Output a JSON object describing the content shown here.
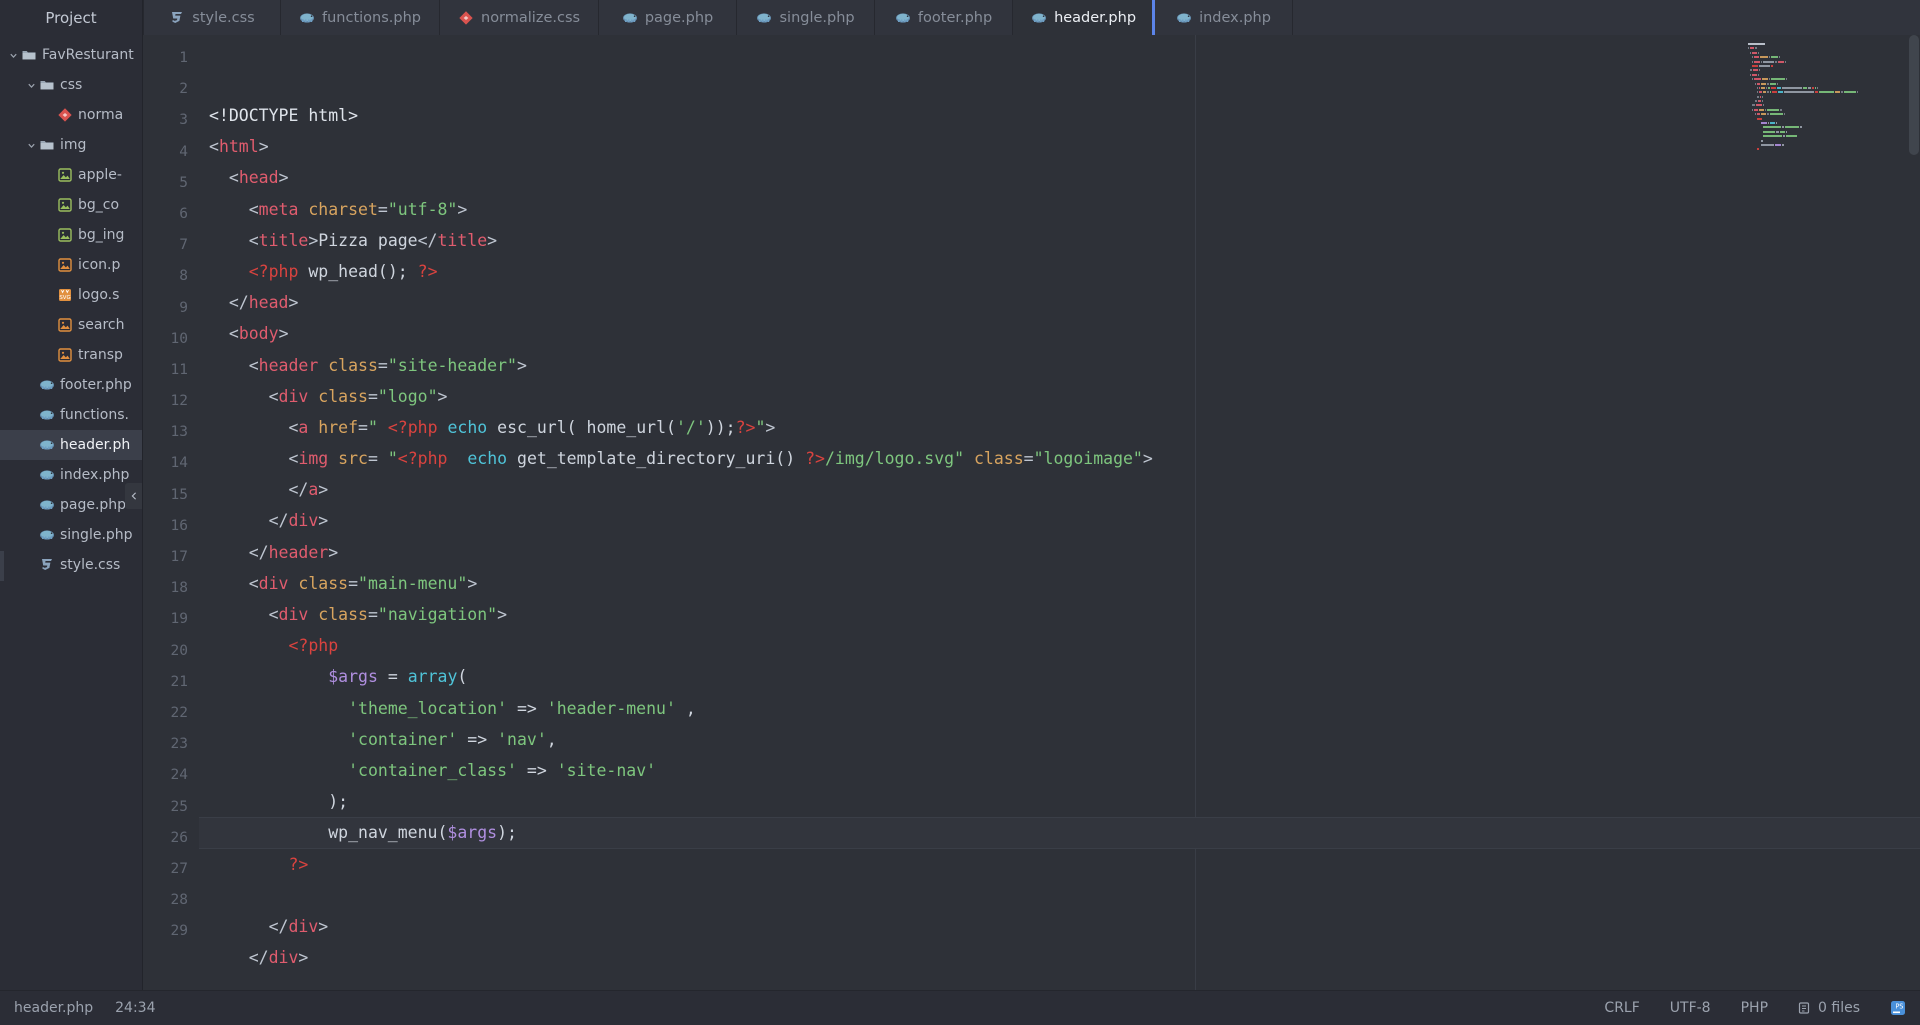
{
  "window": {
    "theme_bg": "#2b2d36",
    "editor_bg": "#2e3138",
    "accent": "#5c84e8"
  },
  "sidebar": {
    "title": "Project",
    "items": [
      {
        "label": "FavResturant",
        "type": "folder",
        "depth": 0,
        "arrow": "chevron-down",
        "selected": false
      },
      {
        "label": "css",
        "type": "folder",
        "depth": 1,
        "arrow": "chevron-down",
        "selected": false
      },
      {
        "label": "norma",
        "type": "css-normalize",
        "depth": 2,
        "arrow": "",
        "selected": false
      },
      {
        "label": "img",
        "type": "folder",
        "depth": 1,
        "arrow": "chevron-down",
        "selected": false
      },
      {
        "label": "apple-",
        "type": "image-green",
        "depth": 2,
        "arrow": "",
        "selected": false
      },
      {
        "label": "bg_co",
        "type": "image-green",
        "depth": 2,
        "arrow": "",
        "selected": false
      },
      {
        "label": "bg_ing",
        "type": "image-green",
        "depth": 2,
        "arrow": "",
        "selected": false
      },
      {
        "label": "icon.p",
        "type": "image-orange",
        "depth": 2,
        "arrow": "",
        "selected": false
      },
      {
        "label": "logo.s",
        "type": "svg",
        "depth": 2,
        "arrow": "",
        "selected": false
      },
      {
        "label": "search",
        "type": "image-orange",
        "depth": 2,
        "arrow": "",
        "selected": false
      },
      {
        "label": "transp",
        "type": "image-orange",
        "depth": 2,
        "arrow": "",
        "selected": false
      },
      {
        "label": "footer.php",
        "type": "php",
        "depth": 1,
        "arrow": "",
        "selected": false
      },
      {
        "label": "functions.",
        "type": "php",
        "depth": 1,
        "arrow": "",
        "selected": false
      },
      {
        "label": "header.ph",
        "type": "php",
        "depth": 1,
        "arrow": "",
        "selected": true
      },
      {
        "label": "index.php",
        "type": "php",
        "depth": 1,
        "arrow": "",
        "selected": false
      },
      {
        "label": "page.php",
        "type": "php",
        "depth": 1,
        "arrow": "",
        "selected": false
      },
      {
        "label": "single.php",
        "type": "php",
        "depth": 1,
        "arrow": "",
        "selected": false
      },
      {
        "label": "style.css",
        "type": "css",
        "depth": 1,
        "arrow": "",
        "selected": false
      }
    ],
    "collapse_icon": "chevron-left-icon"
  },
  "tabs": [
    {
      "label": "style.css",
      "type": "css",
      "active": false
    },
    {
      "label": "functions.php",
      "type": "php",
      "active": false
    },
    {
      "label": "normalize.css",
      "type": "css-normalize",
      "active": false
    },
    {
      "label": "page.php",
      "type": "php",
      "active": false
    },
    {
      "label": "single.php",
      "type": "php",
      "active": false
    },
    {
      "label": "footer.php",
      "type": "php",
      "active": false
    },
    {
      "label": "header.php",
      "type": "php",
      "active": true
    },
    {
      "label": "index.php",
      "type": "php",
      "active": false
    }
  ],
  "editor": {
    "first_line": 1,
    "caret_line": 24,
    "lines": [
      {
        "n": 1,
        "tokens": [
          {
            "t": "<!DOCTYPE html>",
            "c": "t-doctype"
          }
        ]
      },
      {
        "n": 2,
        "tokens": [
          {
            "t": "<",
            "c": "t-punct"
          },
          {
            "t": "html",
            "c": "t-tag"
          },
          {
            "t": ">",
            "c": "t-punct"
          }
        ]
      },
      {
        "n": 3,
        "tokens": [
          {
            "t": "  <",
            "c": "t-punct"
          },
          {
            "t": "head",
            "c": "t-tag"
          },
          {
            "t": ">",
            "c": "t-punct"
          }
        ]
      },
      {
        "n": 4,
        "tokens": [
          {
            "t": "    <",
            "c": "t-punct"
          },
          {
            "t": "meta ",
            "c": "t-tag"
          },
          {
            "t": "charset",
            "c": "t-attr"
          },
          {
            "t": "=",
            "c": "t-punct"
          },
          {
            "t": "\"utf-8\"",
            "c": "t-str"
          },
          {
            "t": ">",
            "c": "t-punct"
          }
        ]
      },
      {
        "n": 5,
        "tokens": [
          {
            "t": "    <",
            "c": "t-punct"
          },
          {
            "t": "title",
            "c": "t-tag"
          },
          {
            "t": ">",
            "c": "t-punct"
          },
          {
            "t": "Pizza page",
            "c": "t-plain"
          },
          {
            "t": "</",
            "c": "t-punct"
          },
          {
            "t": "title",
            "c": "t-tag"
          },
          {
            "t": ">",
            "c": "t-punct"
          }
        ]
      },
      {
        "n": 6,
        "tokens": [
          {
            "t": "    ",
            "c": "t-plain"
          },
          {
            "t": "<?php",
            "c": "t-php"
          },
          {
            "t": " wp_head(); ",
            "c": "t-plain"
          },
          {
            "t": "?>",
            "c": "t-php"
          }
        ]
      },
      {
        "n": 7,
        "tokens": [
          {
            "t": "  </",
            "c": "t-punct"
          },
          {
            "t": "head",
            "c": "t-tag"
          },
          {
            "t": ">",
            "c": "t-punct"
          }
        ]
      },
      {
        "n": 8,
        "tokens": [
          {
            "t": "  <",
            "c": "t-punct"
          },
          {
            "t": "body",
            "c": "t-tag"
          },
          {
            "t": ">",
            "c": "t-punct"
          }
        ]
      },
      {
        "n": 9,
        "tokens": [
          {
            "t": "    <",
            "c": "t-punct"
          },
          {
            "t": "header ",
            "c": "t-tag"
          },
          {
            "t": "class",
            "c": "t-attr"
          },
          {
            "t": "=",
            "c": "t-punct"
          },
          {
            "t": "\"site-header\"",
            "c": "t-str"
          },
          {
            "t": ">",
            "c": "t-punct"
          }
        ]
      },
      {
        "n": 10,
        "tokens": [
          {
            "t": "      <",
            "c": "t-punct"
          },
          {
            "t": "div ",
            "c": "t-tag"
          },
          {
            "t": "class",
            "c": "t-attr"
          },
          {
            "t": "=",
            "c": "t-punct"
          },
          {
            "t": "\"logo\"",
            "c": "t-str"
          },
          {
            "t": ">",
            "c": "t-punct"
          }
        ]
      },
      {
        "n": 11,
        "tokens": [
          {
            "t": "        <",
            "c": "t-punct"
          },
          {
            "t": "a ",
            "c": "t-tag"
          },
          {
            "t": "href",
            "c": "t-attr"
          },
          {
            "t": "=",
            "c": "t-punct"
          },
          {
            "t": "\" ",
            "c": "t-str"
          },
          {
            "t": "<?php",
            "c": "t-php"
          },
          {
            "t": " ",
            "c": "t-plain"
          },
          {
            "t": "echo",
            "c": "t-kw"
          },
          {
            "t": " esc_url( home_url(",
            "c": "t-plain"
          },
          {
            "t": "'/'",
            "c": "t-str"
          },
          {
            "t": "));",
            "c": "t-plain"
          },
          {
            "t": "?>",
            "c": "t-php"
          },
          {
            "t": "\"",
            "c": "t-str"
          },
          {
            "t": ">",
            "c": "t-punct"
          }
        ]
      },
      {
        "n": 12,
        "tokens": [
          {
            "t": "        <",
            "c": "t-punct"
          },
          {
            "t": "img ",
            "c": "t-tag"
          },
          {
            "t": "src",
            "c": "t-attr"
          },
          {
            "t": "= ",
            "c": "t-punct"
          },
          {
            "t": "\"",
            "c": "t-str"
          },
          {
            "t": "<?php",
            "c": "t-php"
          },
          {
            "t": "  ",
            "c": "t-plain"
          },
          {
            "t": "echo",
            "c": "t-kw"
          },
          {
            "t": " get_template_directory_uri() ",
            "c": "t-plain"
          },
          {
            "t": "?>",
            "c": "t-php"
          },
          {
            "t": "/img/logo.svg\"",
            "c": "t-str"
          },
          {
            "t": " ",
            "c": "t-plain"
          },
          {
            "t": "class",
            "c": "t-attr"
          },
          {
            "t": "=",
            "c": "t-punct"
          },
          {
            "t": "\"logoimage\"",
            "c": "t-str"
          },
          {
            "t": ">",
            "c": "t-punct"
          }
        ]
      },
      {
        "n": 13,
        "tokens": [
          {
            "t": "        </",
            "c": "t-punct"
          },
          {
            "t": "a",
            "c": "t-tag"
          },
          {
            "t": ">",
            "c": "t-punct"
          }
        ]
      },
      {
        "n": 14,
        "tokens": [
          {
            "t": "      </",
            "c": "t-punct"
          },
          {
            "t": "div",
            "c": "t-tag"
          },
          {
            "t": ">",
            "c": "t-punct"
          }
        ]
      },
      {
        "n": 15,
        "tokens": [
          {
            "t": "    </",
            "c": "t-punct"
          },
          {
            "t": "header",
            "c": "t-tag"
          },
          {
            "t": ">",
            "c": "t-punct"
          }
        ]
      },
      {
        "n": 16,
        "tokens": [
          {
            "t": "    <",
            "c": "t-punct"
          },
          {
            "t": "div ",
            "c": "t-tag"
          },
          {
            "t": "class",
            "c": "t-attr"
          },
          {
            "t": "=",
            "c": "t-punct"
          },
          {
            "t": "\"main-menu\"",
            "c": "t-str"
          },
          {
            "t": ">",
            "c": "t-punct"
          }
        ]
      },
      {
        "n": 17,
        "tokens": [
          {
            "t": "      <",
            "c": "t-punct"
          },
          {
            "t": "div ",
            "c": "t-tag"
          },
          {
            "t": "class",
            "c": "t-attr"
          },
          {
            "t": "=",
            "c": "t-punct"
          },
          {
            "t": "\"navigation\"",
            "c": "t-str"
          },
          {
            "t": ">",
            "c": "t-punct"
          }
        ]
      },
      {
        "n": 18,
        "tokens": [
          {
            "t": "        ",
            "c": "t-plain"
          },
          {
            "t": "<?php",
            "c": "t-php"
          }
        ]
      },
      {
        "n": 19,
        "tokens": [
          {
            "t": "            ",
            "c": "t-plain"
          },
          {
            "t": "$args",
            "c": "t-var"
          },
          {
            "t": " = ",
            "c": "t-plain"
          },
          {
            "t": "array",
            "c": "t-kw"
          },
          {
            "t": "(",
            "c": "t-plain"
          }
        ]
      },
      {
        "n": 20,
        "tokens": [
          {
            "t": "              ",
            "c": "t-plain"
          },
          {
            "t": "'theme_location'",
            "c": "t-str"
          },
          {
            "t": " => ",
            "c": "t-plain"
          },
          {
            "t": "'header-menu'",
            "c": "t-str"
          },
          {
            "t": " ,",
            "c": "t-plain"
          }
        ]
      },
      {
        "n": 21,
        "tokens": [
          {
            "t": "              ",
            "c": "t-plain"
          },
          {
            "t": "'container'",
            "c": "t-str"
          },
          {
            "t": " => ",
            "c": "t-plain"
          },
          {
            "t": "'nav'",
            "c": "t-str"
          },
          {
            "t": ",",
            "c": "t-plain"
          }
        ]
      },
      {
        "n": 22,
        "tokens": [
          {
            "t": "              ",
            "c": "t-plain"
          },
          {
            "t": "'container_class'",
            "c": "t-str"
          },
          {
            "t": " => ",
            "c": "t-plain"
          },
          {
            "t": "'site-nav'",
            "c": "t-str"
          }
        ]
      },
      {
        "n": 23,
        "tokens": [
          {
            "t": "            );",
            "c": "t-plain"
          }
        ]
      },
      {
        "n": 24,
        "tokens": [
          {
            "t": "            wp_nav_menu(",
            "c": "t-plain"
          },
          {
            "t": "$args",
            "c": "t-var"
          },
          {
            "t": ");",
            "c": "t-plain"
          }
        ]
      },
      {
        "n": 25,
        "tokens": [
          {
            "t": "        ",
            "c": "t-plain"
          },
          {
            "t": "?>",
            "c": "t-php"
          }
        ]
      },
      {
        "n": 26,
        "tokens": []
      },
      {
        "n": 27,
        "tokens": [
          {
            "t": "      </",
            "c": "t-punct"
          },
          {
            "t": "div",
            "c": "t-tag"
          },
          {
            "t": ">",
            "c": "t-punct"
          }
        ]
      },
      {
        "n": 28,
        "tokens": [
          {
            "t": "    </",
            "c": "t-punct"
          },
          {
            "t": "div",
            "c": "t-tag"
          },
          {
            "t": ">",
            "c": "t-punct"
          }
        ]
      },
      {
        "n": 29,
        "tokens": []
      }
    ]
  },
  "status_bar": {
    "file": "header.php",
    "caret": "24:34",
    "line_separator": "CRLF",
    "encoding": "UTF-8",
    "language": "PHP",
    "vcs_files": "0 files",
    "vcs_icon": "branch-icon",
    "ide_icon": "ide-logo-icon"
  }
}
